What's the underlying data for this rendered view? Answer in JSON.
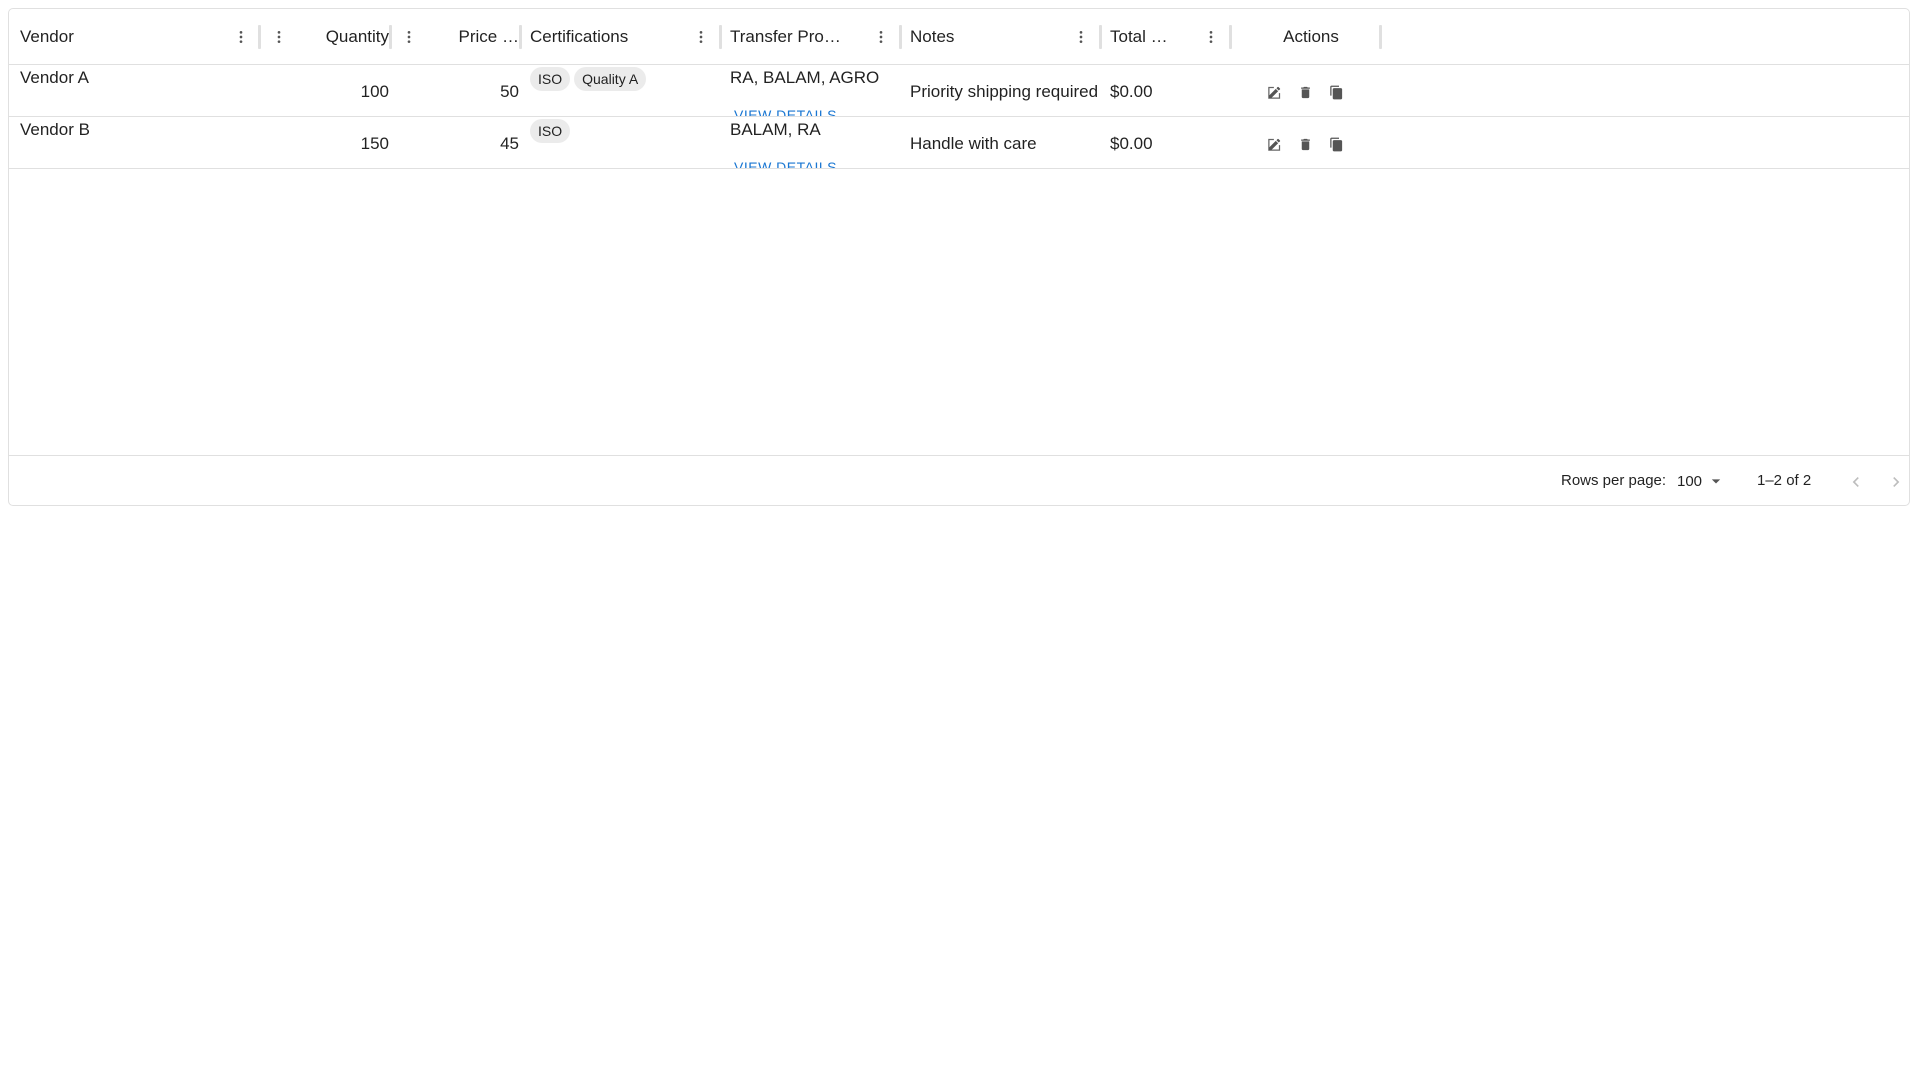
{
  "columns": {
    "vendor": "Vendor",
    "quantity": "Quantity",
    "price": "Price …",
    "certifications": "Certifications",
    "transfer": "Transfer Prop…",
    "notes": "Notes",
    "total": "Total …",
    "actions": "Actions"
  },
  "rows": [
    {
      "vendor": "Vendor A",
      "quantity": "100",
      "price": "50",
      "certifications": [
        "ISO",
        "Quality A"
      ],
      "transfer": "RA, BALAM, AGRO",
      "transfer_link": "VIEW DETAILS",
      "notes": "Priority shipping required",
      "total": "$0.00"
    },
    {
      "vendor": "Vendor B",
      "quantity": "150",
      "price": "45",
      "certifications": [
        "ISO"
      ],
      "transfer": "BALAM, RA",
      "transfer_link": "VIEW DETAILS",
      "notes": "Handle with care",
      "total": "$0.00"
    }
  ],
  "footer": {
    "rows_per_page_label": "Rows per page:",
    "rows_per_page_value": "100",
    "range": "1–2 of 2"
  }
}
